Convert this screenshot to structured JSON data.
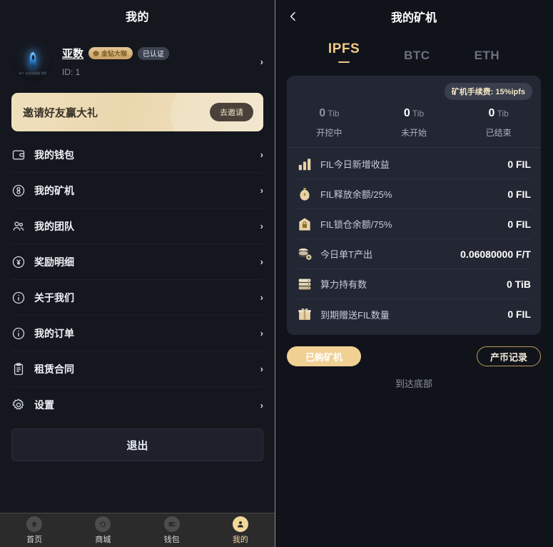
{
  "left": {
    "header_title": "我的",
    "profile": {
      "name": "亚数",
      "vip_badge": "金钻大咖",
      "verified_badge": "已认证",
      "id_label": "ID: 1",
      "chevron": "›",
      "avatar_caption": "NFT 以太坊轻松\n挖矿"
    },
    "invite": {
      "title": "邀请好友赢大礼",
      "button": "去邀请"
    },
    "menu": [
      {
        "label": "我的钱包",
        "icon": "wallet-icon",
        "chevron": "›"
      },
      {
        "label": "我的矿机",
        "icon": "miner-icon",
        "chevron": "›"
      },
      {
        "label": "我的团队",
        "icon": "team-icon",
        "chevron": "›"
      },
      {
        "label": "奖励明细",
        "icon": "reward-icon",
        "chevron": "›"
      },
      {
        "label": "关于我们",
        "icon": "info-icon",
        "chevron": "›"
      },
      {
        "label": "我的订单",
        "icon": "order-icon",
        "chevron": "›"
      },
      {
        "label": "租赁合同",
        "icon": "contract-icon",
        "chevron": "›"
      },
      {
        "label": "设置",
        "icon": "gear-icon",
        "chevron": "›"
      }
    ],
    "logout_label": "退出",
    "tabbar": [
      {
        "label": "首页",
        "icon": "home-icon",
        "active": false
      },
      {
        "label": "商城",
        "icon": "shop-icon",
        "active": false
      },
      {
        "label": "钱包",
        "icon": "wallet-icon",
        "active": false
      },
      {
        "label": "我的",
        "icon": "profile-icon",
        "active": true
      }
    ]
  },
  "right": {
    "header_title": "我的矿机",
    "back_icon": "chevron-left-icon",
    "coin_tabs": [
      {
        "label": "IPFS",
        "active": true
      },
      {
        "label": "BTC",
        "active": false
      },
      {
        "label": "ETH",
        "active": false
      }
    ],
    "fee_pill": "矿机手续费: 15%ipfs",
    "stats": [
      {
        "value": "0",
        "unit": "Tib",
        "label": "开挖中",
        "bright": false
      },
      {
        "value": "0",
        "unit": "Tib",
        "label": "未开始",
        "bright": true
      },
      {
        "value": "0",
        "unit": "Tib",
        "label": "已结束",
        "bright": true
      }
    ],
    "rows": [
      {
        "icon": "bar-chart-icon",
        "label": "FIL今日新增收益",
        "value": "0 FIL"
      },
      {
        "icon": "money-bag-icon",
        "label": "FIL释放余额/25%",
        "value": "0 FIL"
      },
      {
        "icon": "vault-icon",
        "label": "FIL锁仓余额/75%",
        "value": "0 FIL"
      },
      {
        "icon": "coin-stack-icon",
        "label": "今日单T产出",
        "value": "0.06080000 F/T"
      },
      {
        "icon": "server-icon",
        "label": "算力持有数",
        "value": "0 TiB"
      },
      {
        "icon": "gift-icon",
        "label": "到期赠送FIL数量",
        "value": "0 FIL"
      }
    ],
    "actions": {
      "owned_label": "已购矿机",
      "record_label": "产币记录"
    },
    "bottom_note": "到达底部"
  },
  "colors": {
    "accent_gold": "#f0c987",
    "panel_bg": "#15171f",
    "card_bg": "#232733",
    "right_bg": "#11131b"
  }
}
